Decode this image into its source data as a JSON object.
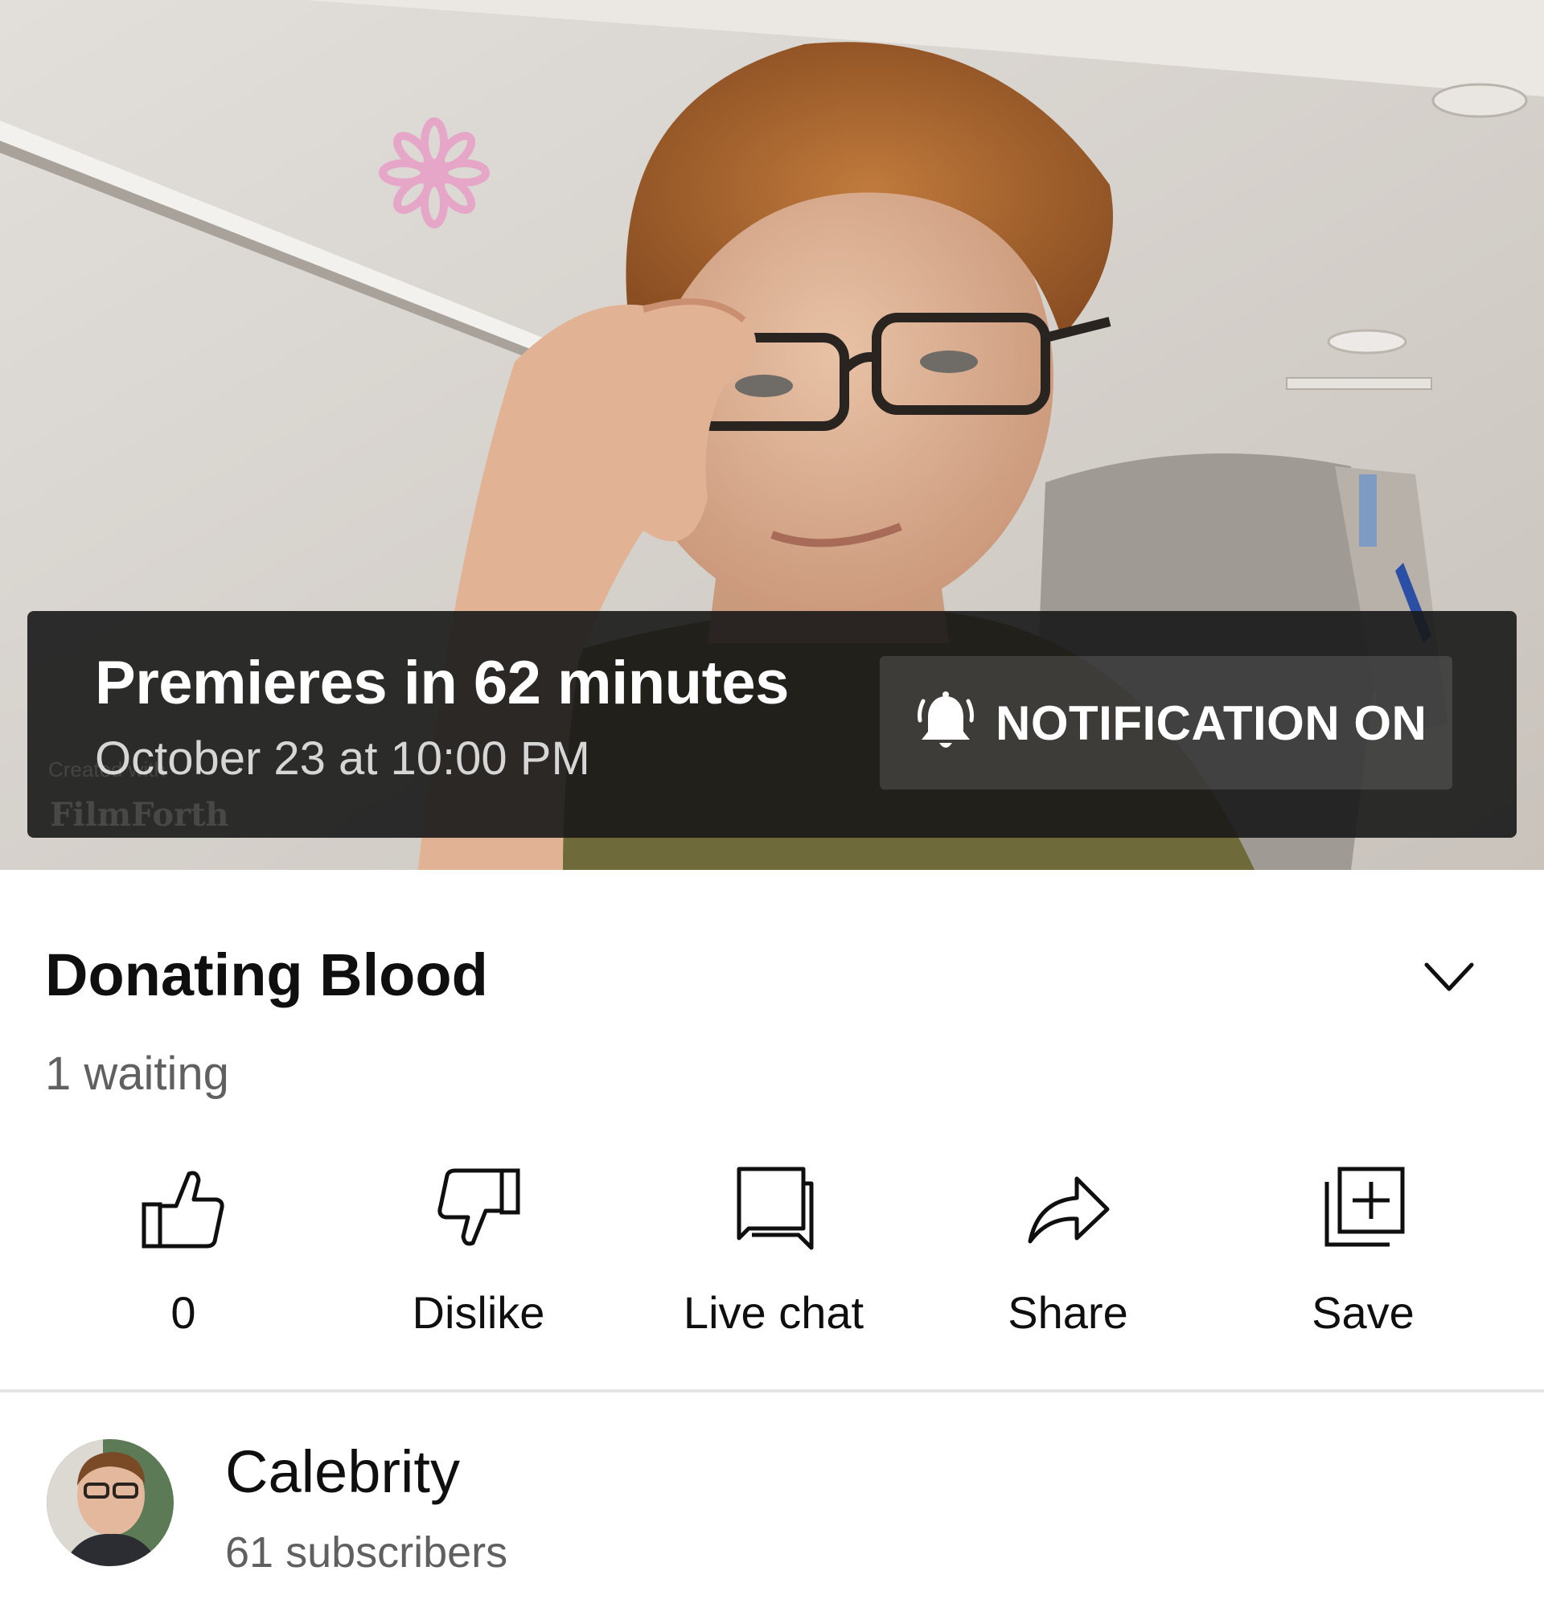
{
  "player": {
    "premiere_title": "Premieres in 62 minutes",
    "premiere_date": "October 23 at 10:00 PM",
    "notification_button_label": "NOTIFICATION ON",
    "watermark_line1": "Created with",
    "watermark_line2": "FilmForth"
  },
  "video": {
    "title": "Donating Blood",
    "waiting_count": "1 waiting"
  },
  "actions": {
    "like_count": "0",
    "dislike_label": "Dislike",
    "live_chat_label": "Live chat",
    "share_label": "Share",
    "save_label": "Save"
  },
  "channel": {
    "name": "Calebrity",
    "subscribers": "61 subscribers"
  },
  "icons": {
    "notification": "bell-ringing-icon",
    "expand": "chevron-down-icon",
    "like": "thumbs-up-icon",
    "dislike": "thumbs-down-icon",
    "live_chat": "chat-bubble-icon",
    "share": "share-arrow-icon",
    "save": "playlist-add-icon"
  },
  "colors": {
    "text_primary": "#0f0f0f",
    "text_secondary": "#606060",
    "overlay": "#181818",
    "background": "#ffffff"
  }
}
